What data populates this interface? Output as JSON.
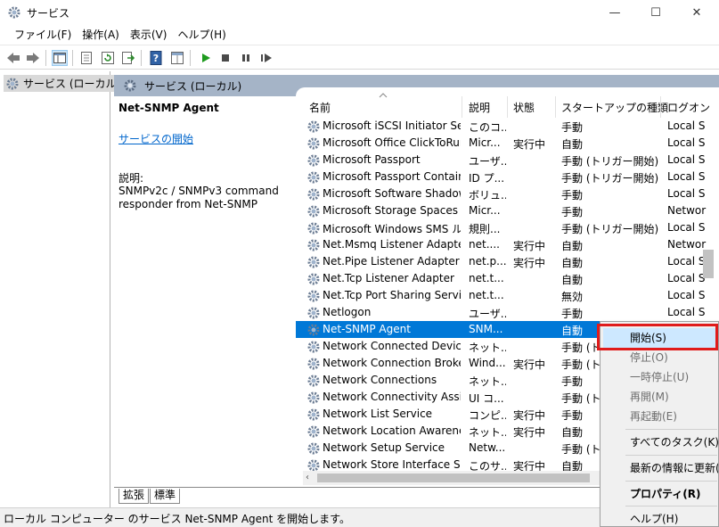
{
  "window": {
    "title": "サービス",
    "minimize": "—",
    "maximize": "☐",
    "close": "✕"
  },
  "menu": [
    "ファイル(F)",
    "操作(A)",
    "表示(V)",
    "ヘルプ(H)"
  ],
  "tree": {
    "root": "サービス (ローカル)"
  },
  "header_band": "サービス (ローカル)",
  "detail": {
    "title": "Net-SNMP Agent",
    "start_link": "サービスの開始",
    "desc_label": "説明:",
    "desc": "SNMPv2c / SNMPv3 command responder from Net-SNMP"
  },
  "columns": {
    "name": "名前",
    "desc": "説明",
    "status": "状態",
    "startup": "スタートアップの種類",
    "logon": "ログオン"
  },
  "rows": [
    {
      "name": "Microsoft iSCSI Initiator Ser...",
      "desc": "このコ...",
      "status": "",
      "startup": "手動",
      "logon": "Local S"
    },
    {
      "name": "Microsoft Office ClickToRun...",
      "desc": "Micr...",
      "status": "実行中",
      "startup": "自動",
      "logon": "Local S"
    },
    {
      "name": "Microsoft Passport",
      "desc": "ユーザ...",
      "status": "",
      "startup": "手動 (トリガー開始)",
      "logon": "Local S"
    },
    {
      "name": "Microsoft Passport Container",
      "desc": "ID プ...",
      "status": "",
      "startup": "手動 (トリガー開始)",
      "logon": "Local S"
    },
    {
      "name": "Microsoft Software Shadow...",
      "desc": "ボリュ...",
      "status": "",
      "startup": "手動",
      "logon": "Local S"
    },
    {
      "name": "Microsoft Storage Spaces S...",
      "desc": "Micr...",
      "status": "",
      "startup": "手動",
      "logon": "Networ"
    },
    {
      "name": "Microsoft Windows SMS ル...",
      "desc": "規則...",
      "status": "",
      "startup": "手動 (トリガー開始)",
      "logon": "Local S"
    },
    {
      "name": "Net.Msmq Listener Adapter",
      "desc": "net....",
      "status": "実行中",
      "startup": "自動",
      "logon": "Networ"
    },
    {
      "name": "Net.Pipe Listener Adapter",
      "desc": "net.p...",
      "status": "実行中",
      "startup": "自動",
      "logon": "Local S"
    },
    {
      "name": "Net.Tcp Listener Adapter",
      "desc": "net.t...",
      "status": "",
      "startup": "自動",
      "logon": "Local S"
    },
    {
      "name": "Net.Tcp Port Sharing Service",
      "desc": "net.t...",
      "status": "",
      "startup": "無効",
      "logon": "Local S"
    },
    {
      "name": "Netlogon",
      "desc": "ユーザ...",
      "status": "",
      "startup": "手動",
      "logon": "Local S"
    },
    {
      "name": "Net-SNMP Agent",
      "desc": "SNM...",
      "status": "",
      "startup": "自動",
      "logon": ""
    },
    {
      "name": "Network Connected Device...",
      "desc": "ネット...",
      "status": "",
      "startup": "手動 (ト",
      "logon": ""
    },
    {
      "name": "Network Connection Broker",
      "desc": "Wind...",
      "status": "実行中",
      "startup": "手動 (ト",
      "logon": ""
    },
    {
      "name": "Network Connections",
      "desc": "ネット...",
      "status": "",
      "startup": "手動",
      "logon": ""
    },
    {
      "name": "Network Connectivity Assist...",
      "desc": "UI コ...",
      "status": "",
      "startup": "手動 (ト",
      "logon": ""
    },
    {
      "name": "Network List Service",
      "desc": "コンピ...",
      "status": "実行中",
      "startup": "手動",
      "logon": ""
    },
    {
      "name": "Network Location Awareness",
      "desc": "ネット...",
      "status": "実行中",
      "startup": "自動",
      "logon": ""
    },
    {
      "name": "Network Setup Service",
      "desc": "Netw...",
      "status": "",
      "startup": "手動 (ト",
      "logon": ""
    },
    {
      "name": "Network Store Interface Ser...",
      "desc": "このサ...",
      "status": "実行中",
      "startup": "自動",
      "logon": ""
    }
  ],
  "tabs": [
    "拡張",
    "標準"
  ],
  "status_text": "ローカル コンピューター のサービス Net-SNMP Agent を開始します。",
  "context_menu": {
    "start": "開始(S)",
    "stop": "停止(O)",
    "pause": "一時停止(U)",
    "resume": "再開(M)",
    "restart": "再起動(E)",
    "all_tasks": "すべてのタスク(K)",
    "refresh": "最新の情報に更新(F)",
    "properties": "プロパティ(R)",
    "help": "ヘルプ(H)"
  },
  "colors": {
    "selection": "#0078d7",
    "highlight_box": "#e01b1b",
    "header_band": "#a5b4c7"
  }
}
